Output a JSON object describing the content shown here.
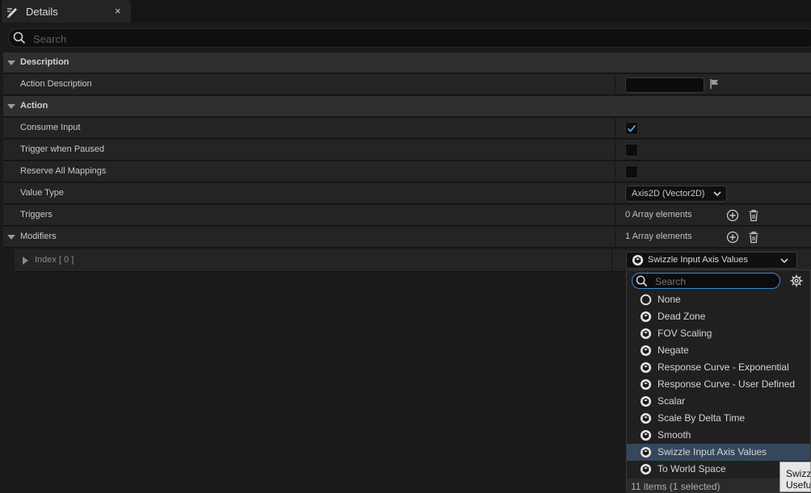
{
  "tab": {
    "title": "Details",
    "close": "×"
  },
  "search": {
    "placeholder": "Search"
  },
  "categories": {
    "description": "Description",
    "action": "Action"
  },
  "properties": {
    "action_description": {
      "label": "Action Description",
      "value": ""
    },
    "consume_input": {
      "label": "Consume Input",
      "checked": true
    },
    "trigger_when_paused": {
      "label": "Trigger when Paused",
      "checked": false
    },
    "reserve_all_mappings": {
      "label": "Reserve All Mappings",
      "checked": false
    },
    "value_type": {
      "label": "Value Type",
      "value": "Axis2D (Vector2D)"
    },
    "triggers": {
      "label": "Triggers",
      "value": "0 Array elements"
    },
    "modifiers": {
      "label": "Modifiers",
      "value": "1 Array elements"
    },
    "index0": {
      "label": "Index [ 0 ]",
      "value": "Swizzle Input Axis Values"
    }
  },
  "dropdown": {
    "search_placeholder": "Search",
    "options": [
      {
        "label": "None",
        "icon": "none-circle-icon"
      },
      {
        "label": "Dead Zone",
        "icon": "class-icon"
      },
      {
        "label": "FOV Scaling",
        "icon": "class-icon"
      },
      {
        "label": "Negate",
        "icon": "class-icon"
      },
      {
        "label": "Response Curve - Exponential",
        "icon": "class-icon"
      },
      {
        "label": "Response Curve - User Defined",
        "icon": "class-icon"
      },
      {
        "label": "Scalar",
        "icon": "class-icon"
      },
      {
        "label": "Scale By Delta Time",
        "icon": "class-icon"
      },
      {
        "label": "Smooth",
        "icon": "class-icon"
      },
      {
        "label": "Swizzle Input Axis Values",
        "icon": "class-icon"
      },
      {
        "label": "To World Space",
        "icon": "class-icon"
      }
    ],
    "selected_index": 9,
    "footer": "11 items (1 selected)"
  },
  "tooltip": {
    "line1": "Swizz",
    "line2": "Usefu"
  },
  "colors": {
    "accent": "#3d8bd9",
    "selected_row": "#34475c",
    "checkmark": "#5aa0e6"
  }
}
